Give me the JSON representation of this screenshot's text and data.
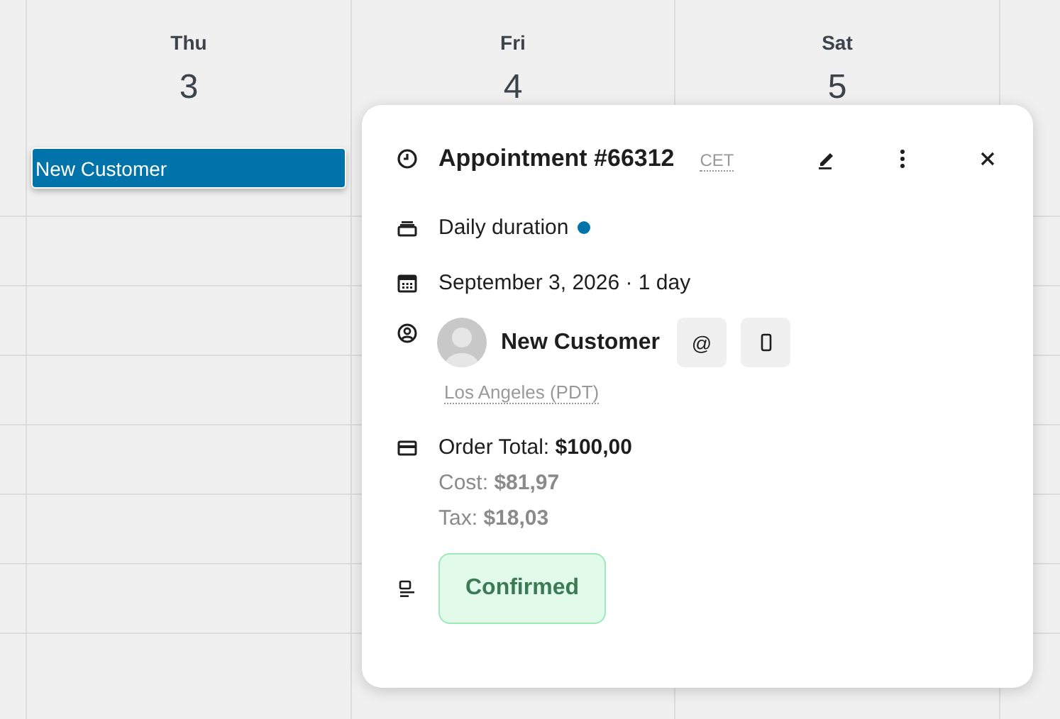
{
  "calendar": {
    "days": [
      {
        "name": "Thu",
        "number": "3"
      },
      {
        "name": "Fri",
        "number": "4"
      },
      {
        "name": "Sat",
        "number": "5"
      }
    ],
    "events": [
      {
        "title": "New Customer",
        "color": "#0073aa"
      }
    ]
  },
  "popover": {
    "title": "Appointment #66312",
    "timezone": "CET",
    "service": {
      "name": "Daily duration",
      "color": "#0073aa"
    },
    "date": "September 3, 2026 · 1 day",
    "customer": {
      "name": "New Customer",
      "location": "Los Angeles (PDT)",
      "contact_buttons": [
        "@"
      ]
    },
    "order": {
      "total": "Order Total: **$100,00**",
      "lines": [
        "Cost: **$81,97**",
        "Tax: **$18,03**"
      ]
    },
    "status": {
      "label": "Confirmed",
      "kind": "confirmed"
    }
  }
}
